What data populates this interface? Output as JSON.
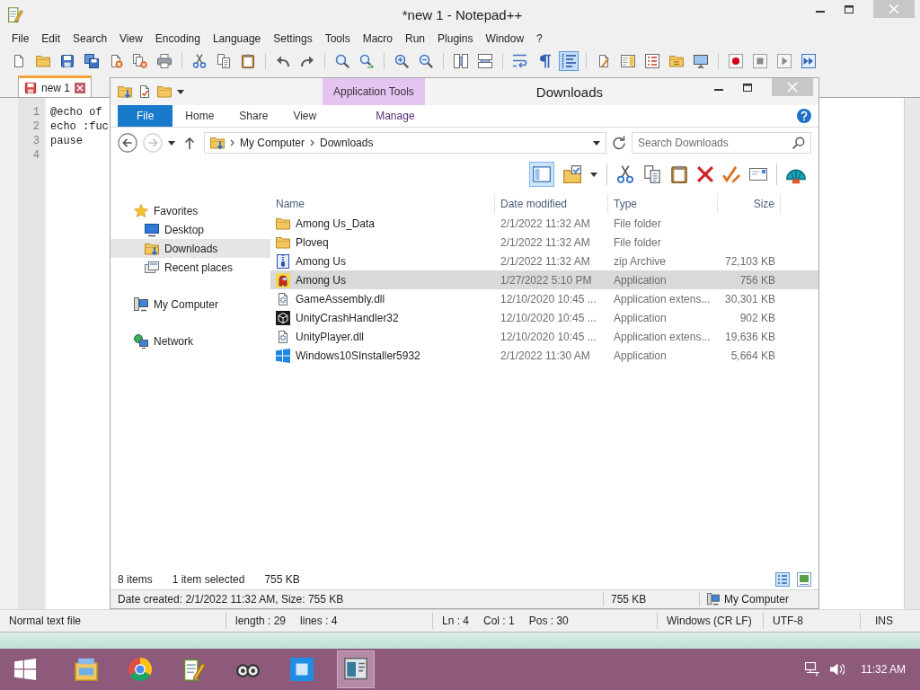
{
  "notepad": {
    "title": "*new 1 - Notepad++",
    "menu": [
      "File",
      "Edit",
      "Search",
      "View",
      "Encoding",
      "Language",
      "Settings",
      "Tools",
      "Macro",
      "Run",
      "Plugins",
      "Window",
      "?"
    ],
    "toolbar": [
      {
        "pressed": false
      },
      {
        "pressed": false
      },
      {
        "pressed": false
      },
      {
        "pressed": false
      },
      {
        "pressed": false
      },
      {
        "pressed": false
      },
      {
        "pressed": false
      },
      {
        "pressed": false
      },
      {
        "pressed": false
      },
      {
        "pressed": false
      },
      {
        "pressed": false
      },
      {
        "pressed": false
      },
      {
        "pressed": false
      },
      {
        "pressed": false
      },
      {
        "pressed": false
      },
      {
        "pressed": false
      },
      {
        "pressed": false
      },
      {
        "pressed": false
      },
      {
        "pressed": false
      },
      {
        "pressed": false
      },
      {
        "pressed": true
      },
      {
        "pressed": false
      },
      {
        "pressed": false
      },
      {
        "pressed": false
      },
      {
        "pressed": false
      },
      {
        "pressed": false
      },
      {
        "pressed": false
      },
      {
        "pressed": false
      },
      {
        "pressed": false
      },
      {
        "pressed": false
      }
    ],
    "tabs": [
      {
        "label": "new 1",
        "selected": true
      }
    ],
    "lines": [
      {
        "number": "1",
        "text": "@echo of"
      },
      {
        "number": "2",
        "text": "echo :fuc"
      },
      {
        "number": "3",
        "text": "pause"
      },
      {
        "number": "4"
      }
    ],
    "status_bar": [
      {
        "texts": [
          "Normal text file"
        ]
      },
      {
        "texts": [
          "length : 29",
          "lines : 4"
        ]
      },
      {
        "texts": [
          "Ln : 4",
          "Col : 1",
          "Pos : 30"
        ]
      },
      {
        "texts": [
          "Windows (CR LF)"
        ]
      },
      {
        "texts": [
          "UTF-8"
        ]
      },
      {
        "texts": [
          "INS"
        ]
      }
    ]
  },
  "explorer": {
    "title": "Downloads",
    "contextual_header": "Application Tools",
    "ribbon_tabs": [
      {
        "label": "File",
        "kind": "file",
        "selected": false
      },
      {
        "label": "Home",
        "kind": "tab",
        "selected": false
      },
      {
        "label": "Share",
        "kind": "tab",
        "selected": false
      },
      {
        "label": "View",
        "kind": "tab",
        "selected": false
      },
      {
        "label": "Manage",
        "kind": "contextual",
        "selected": false
      }
    ],
    "address": [
      "My Computer",
      "Downloads"
    ],
    "search": {
      "placeholder": "Search Downloads"
    },
    "toolbar": [
      {
        "pressed": true
      },
      {
        "pressed": false
      },
      {
        "pressed": false
      },
      {
        "pressed": false
      },
      {
        "pressed": false
      },
      {
        "pressed": false
      },
      {
        "pressed": false
      },
      {
        "pressed": false
      },
      {
        "pressed": false
      },
      {
        "pressed": false
      }
    ],
    "navigation": [
      {
        "label": "Favorites",
        "kind": "favorites",
        "selected": false,
        "children": [
          {
            "label": "Desktop",
            "kind": "desktop",
            "selected": false
          },
          {
            "label": "Downloads",
            "kind": "downloads",
            "selected": true
          },
          {
            "label": "Recent places",
            "kind": "recent",
            "selected": false
          }
        ]
      },
      {
        "label": "My Computer",
        "kind": "computer",
        "selected": false
      },
      {
        "label": "Network",
        "kind": "network",
        "selected": false
      }
    ],
    "columns": [
      "Name",
      "Date modified",
      "Type",
      "Size"
    ],
    "rows": [
      {
        "name": "Among Us_Data",
        "date": "2/1/2022 11:32 AM",
        "type": "File folder",
        "kind": "folder",
        "selected": false
      },
      {
        "name": "Ploveq",
        "date": "2/1/2022 11:32 AM",
        "type": "File folder",
        "kind": "folder",
        "selected": false
      },
      {
        "name": "Among Us",
        "date": "2/1/2022 11:32 AM",
        "type": "zip Archive",
        "size": "72,103 KB",
        "kind": "archive",
        "selected": false
      },
      {
        "name": "Among Us",
        "date": "1/27/2022 5:10 PM",
        "type": "Application",
        "size": "756 KB",
        "kind": "game",
        "selected": true
      },
      {
        "name": "GameAssembly.dll",
        "date": "12/10/2020 10:45 ...",
        "type": "Application extens...",
        "size": "30,301 KB",
        "kind": "library",
        "selected": false
      },
      {
        "name": "UnityCrashHandler32",
        "date": "12/10/2020 10:45 ...",
        "type": "Application",
        "size": "902 KB",
        "kind": "unity",
        "selected": false
      },
      {
        "name": "UnityPlayer.dll",
        "date": "12/10/2020 10:45 ...",
        "type": "Application extens...",
        "size": "19,636 KB",
        "kind": "library",
        "selected": false
      },
      {
        "name": "Windows10SInstaller5932",
        "date": "2/1/2022 11:30 AM",
        "type": "Application",
        "size": "5,664 KB",
        "kind": "installer",
        "selected": false
      }
    ],
    "status": {
      "items": "8 items",
      "selection": "1 item selected",
      "selection_size": "755 KB"
    },
    "view_modes": [
      {
        "selected": true
      },
      {
        "selected": false
      }
    ],
    "details_bar": {
      "info": "Date created: 2/1/2022 11:32 AM, Size: 755 KB",
      "size": "755 KB",
      "location": "My Computer"
    }
  },
  "taskbar": {
    "apps": [
      {
        "active": false
      },
      {
        "active": false
      },
      {
        "active": false
      },
      {
        "active": false
      },
      {
        "active": false
      },
      {
        "active": true
      }
    ],
    "clock": "11:32 AM"
  }
}
